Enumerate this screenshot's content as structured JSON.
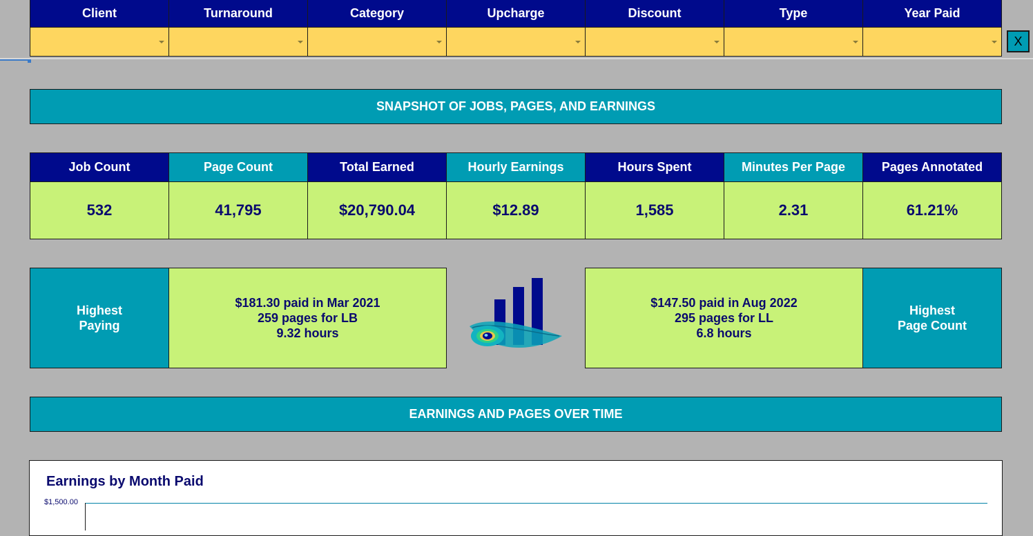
{
  "filters": {
    "columns": [
      {
        "label": "Client",
        "value": ""
      },
      {
        "label": "Turnaround",
        "value": ""
      },
      {
        "label": "Category",
        "value": ""
      },
      {
        "label": "Upcharge",
        "value": ""
      },
      {
        "label": "Discount",
        "value": ""
      },
      {
        "label": "Type",
        "value": ""
      },
      {
        "label": "Year Paid",
        "value": ""
      }
    ],
    "clear_label": "X"
  },
  "snapshot": {
    "title": "SNAPSHOT OF JOBS, PAGES, AND EARNINGS"
  },
  "kpis": [
    {
      "label": "Job Count",
      "value": "532"
    },
    {
      "label": "Page Count",
      "value": "41,795"
    },
    {
      "label": "Total Earned",
      "value": "$20,790.04"
    },
    {
      "label": "Hourly Earnings",
      "value": "$12.89"
    },
    {
      "label": "Hours Spent",
      "value": "1,585"
    },
    {
      "label": "Minutes Per Page",
      "value": "2.31"
    },
    {
      "label": "Pages Annotated",
      "value": "61.21%"
    }
  ],
  "highlights": {
    "highest_paying": {
      "label_line1": "Highest",
      "label_line2": "Paying",
      "line1": "$181.30 paid in Mar 2021",
      "line2": "259 pages for LB",
      "line3": "9.32 hours"
    },
    "highest_page_count": {
      "label_line1": "Highest",
      "label_line2": "Page Count",
      "line1": "$147.50 paid in Aug 2022",
      "line2": "295 pages for LL",
      "line3": "6.8 hours"
    }
  },
  "over_time": {
    "title": "EARNINGS AND PAGES OVER TIME"
  },
  "earnings_chart": {
    "title": "Earnings by Month Paid",
    "y_top_tick": "$1,500.00"
  },
  "colors": {
    "navy": "#000a8c",
    "teal": "#009cb3",
    "lime": "#c8f278",
    "yellow": "#fed65f",
    "background": "#b3b3b3"
  }
}
